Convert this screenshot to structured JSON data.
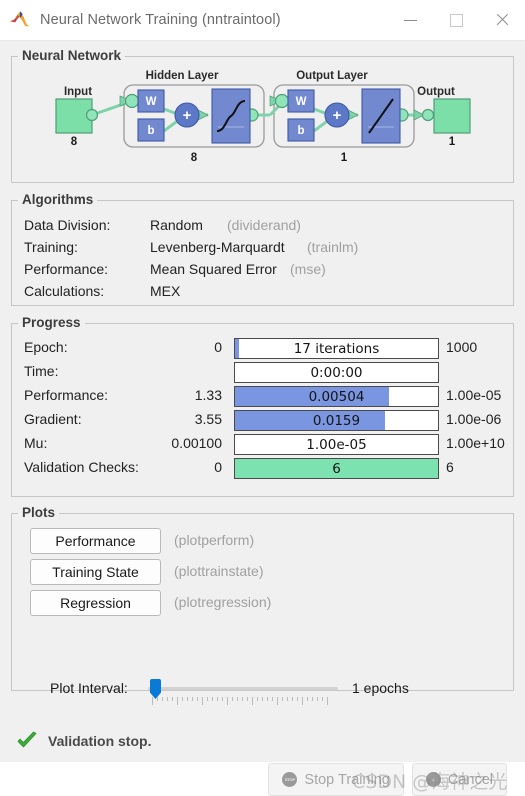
{
  "window": {
    "title": "Neural Network Training (nntraintool)",
    "logo_icon": "matlab-logo-icon",
    "minimize_icon": "minimize-icon",
    "maximize_icon": "maximize-icon",
    "close_icon": "close-icon"
  },
  "neural_network": {
    "legend": "Neural Network",
    "input_label": "Input",
    "input_size": "8",
    "hidden_layer_label": "Hidden Layer",
    "hidden_layer_size": "8",
    "output_layer_label": "Output Layer",
    "output_layer_size": "1",
    "output_label": "Output",
    "output_size": "1",
    "weight_symbol": "W",
    "bias_symbol": "b",
    "sum_symbol": "+",
    "hidden_activation": "sigmoid",
    "output_activation": "linear",
    "colors": {
      "block_blue": "#7289d0",
      "node_green": "#7ddfa8",
      "link_green": "#8bdcb0"
    }
  },
  "algorithms": {
    "legend": "Algorithms",
    "rows": [
      {
        "label": "Data Division:",
        "value": "Random",
        "fn": "(dividerand)"
      },
      {
        "label": "Training:",
        "value": "Levenberg-Marquardt",
        "fn": "(trainlm)"
      },
      {
        "label": "Performance:",
        "value": "Mean Squared Error",
        "fn": "(mse)"
      },
      {
        "label": "Calculations:",
        "value": "MEX",
        "fn": ""
      }
    ]
  },
  "progress": {
    "legend": "Progress",
    "rows": [
      {
        "label": "Epoch:",
        "current": "0",
        "bar_text": "17 iterations",
        "max": "1000",
        "fill_pct": 2,
        "fill_color": "blue"
      },
      {
        "label": "Time:",
        "current": "",
        "bar_text": "0:00:00",
        "max": "",
        "fill_pct": 0,
        "fill_color": "blue"
      },
      {
        "label": "Performance:",
        "current": "1.33",
        "bar_text": "0.00504",
        "max": "1.00e-05",
        "fill_pct": 76,
        "fill_color": "blue"
      },
      {
        "label": "Gradient:",
        "current": "3.55",
        "bar_text": "0.0159",
        "max": "1.00e-06",
        "fill_pct": 74,
        "fill_color": "blue"
      },
      {
        "label": "Mu:",
        "current": "0.00100",
        "bar_text": "1.00e-05",
        "max": "1.00e+10",
        "fill_pct": 0,
        "fill_color": "blue"
      },
      {
        "label": "Validation Checks:",
        "current": "0",
        "bar_text": "6",
        "max": "6",
        "fill_pct": 100,
        "fill_color": "green"
      }
    ],
    "colors": {
      "bar_blue": "#7b96e0",
      "bar_green": "#7ce2b0"
    }
  },
  "plots": {
    "legend": "Plots",
    "buttons": [
      {
        "label": "Performance",
        "fn": "(plotperform)"
      },
      {
        "label": "Training State",
        "fn": "(plottrainstate)"
      },
      {
        "label": "Regression",
        "fn": "(plotregression)"
      }
    ],
    "plot_interval": {
      "label": "Plot Interval:",
      "value_text": "1 epochs",
      "slider_position_pct": 1,
      "thumb_color": "#0a7ad6"
    }
  },
  "status": {
    "icon": "green-check-icon",
    "message": "Validation stop."
  },
  "actions": {
    "stop_training": {
      "label": "Stop Training",
      "icon": "stop-sign-icon",
      "icon_text": "STOP"
    },
    "cancel": {
      "label": "Cancel",
      "icon": "cancel-icon",
      "icon_text": "X"
    }
  },
  "watermark": {
    "text": "CSDN @海神之光"
  }
}
